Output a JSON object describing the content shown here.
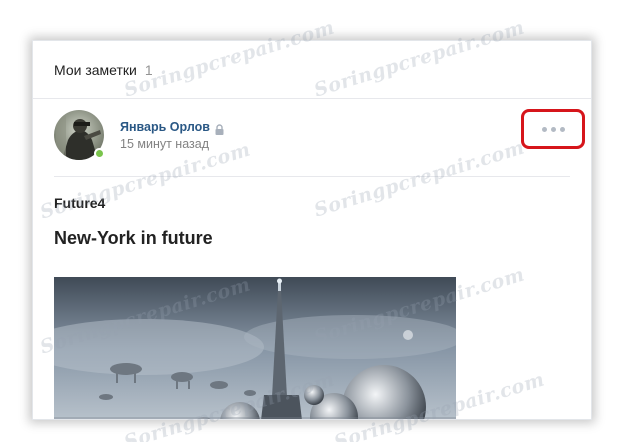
{
  "header": {
    "title": "Мои заметки",
    "count": "1"
  },
  "post": {
    "author_name": "Январь Орлов",
    "time": "15 минут назад",
    "note_name": "Future4",
    "note_title": "New-York in future",
    "image": "futuristic-city-image"
  },
  "icons": {
    "lock": "lock-icon",
    "more": "more-horizontal-icon",
    "online": "online-status-dot"
  },
  "colors": {
    "author_link": "#2a5885",
    "highlight_border": "#d6151b",
    "online": "#7ac44c",
    "muted_text": "#828282"
  },
  "watermark": "Soringpcrepair.com"
}
